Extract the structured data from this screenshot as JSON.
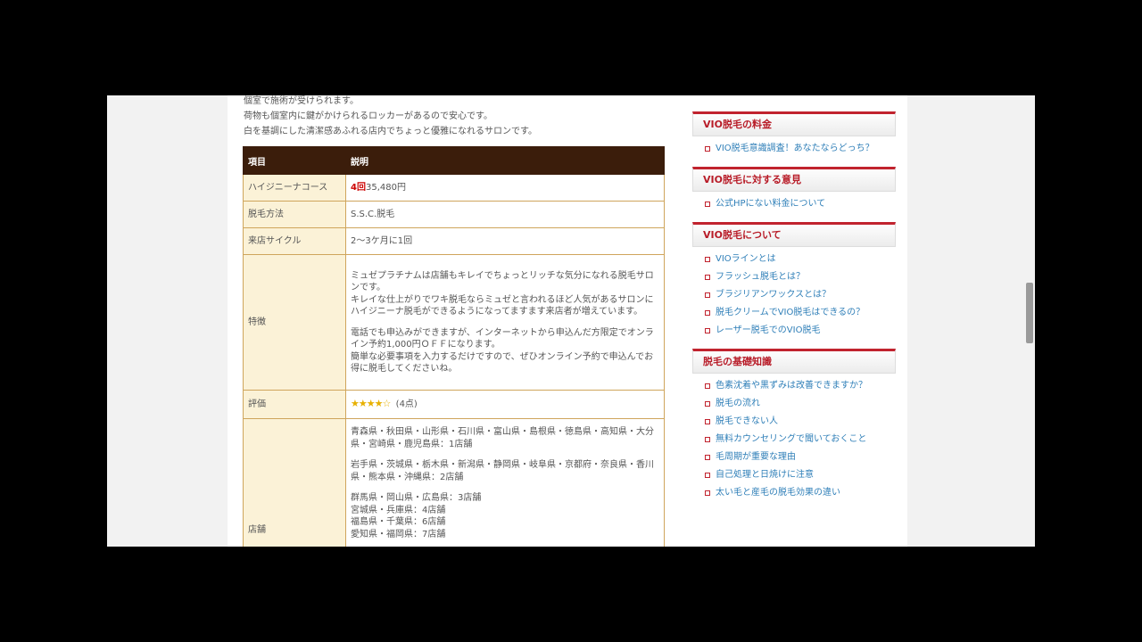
{
  "intro": [
    "個室で施術が受けられます。",
    "荷物も個室内に鍵がかけられるロッカーがあるので安心です。",
    "白を基調にした清潔感あふれる店内でちょっと優雅になれるサロンです。"
  ],
  "table": {
    "headers": [
      "項目",
      "説明"
    ],
    "course": {
      "label": "ハイジニーナコース",
      "count": "4回",
      "price": "35,480円"
    },
    "method": {
      "label": "脱毛方法",
      "value": "S.S.C.脱毛"
    },
    "cycle": {
      "label": "来店サイクル",
      "value": "2～3ケ月に1回"
    },
    "features": {
      "label": "特徴",
      "p1": "ミュゼプラチナムは店舗もキレイでちょっとリッチな気分になれる脱毛サロンです。",
      "p2": "キレイな仕上がりでワキ脱毛ならミュゼと言われるほど人気があるサロンにハイジニーナ脱毛ができるようになってますます来店者が増えています。",
      "p3": "電話でも申込みができますが、インターネットから申込んだ方限定でオンライン予約1,000円ＯＦＦになります。",
      "p4": "簡単な必要事項を入力するだけですので、ぜひオンライン予約で申込んでお得に脱毛してくださいね。"
    },
    "rating": {
      "label": "評価",
      "stars": "★★★★☆",
      "score": "(4点)",
      "value": 4,
      "max": 5
    },
    "stores": {
      "label": "店舗",
      "g1": "青森県・秋田県・山形県・石川県・富山県・島根県・徳島県・高知県・大分県・宮崎県・鹿児島県：1店舗",
      "g2": "岩手県・茨城県・栃木県・新潟県・静岡県・岐阜県・京都府・奈良県・香川県・熊本県・沖縄県：2店舗",
      "l1": "群馬県・岡山県・広島県：3店舗",
      "l2": "宮城県・兵庫県：4店舗",
      "l3": "福島県・千葉県：6店舗",
      "l4": "愛知県・福岡県：7店舗"
    }
  },
  "sidebar": {
    "w1": {
      "title": "VIO脱毛の料金",
      "items": [
        "VIO脱毛意識調査！あなたならどっち？"
      ]
    },
    "w2": {
      "title": "VIO脱毛に対する意見",
      "items": [
        "公式HPにない料金について"
      ]
    },
    "w3": {
      "title": "VIO脱毛について",
      "items": [
        "VIOラインとは",
        "フラッシュ脱毛とは？",
        "ブラジリアンワックスとは？",
        "脱毛クリームでVIO脱毛はできるの？",
        "レーザー脱毛でのVIO脱毛"
      ]
    },
    "w4": {
      "title": "脱毛の基礎知識",
      "items": [
        "色素沈着や黒ずみは改善できますか？",
        "脱毛の流れ",
        "脱毛できない人",
        "無料カウンセリングで聞いておくこと",
        "毛周期が重要な理由",
        "自己処理と日焼けに注意",
        "太い毛と産毛の脱毛効果の違い"
      ]
    }
  }
}
